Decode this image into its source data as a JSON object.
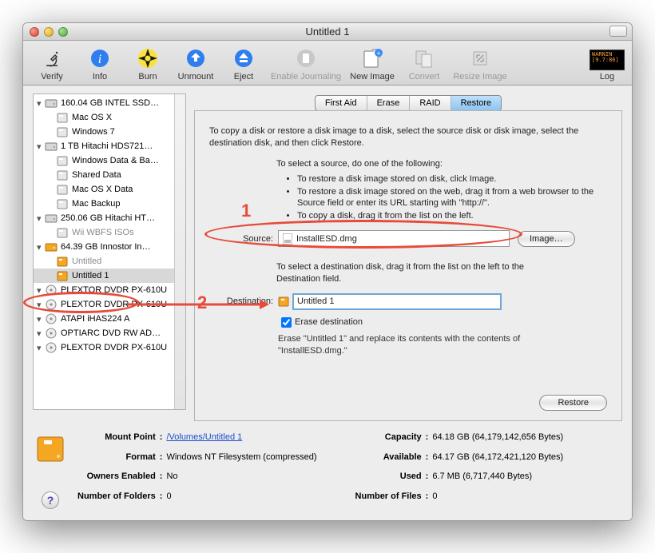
{
  "window": {
    "title": "Untitled 1"
  },
  "toolbar": {
    "verify": "Verify",
    "info": "Info",
    "burn": "Burn",
    "unmount": "Unmount",
    "eject": "Eject",
    "enable_journaling": "Enable Journaling",
    "new_image": "New Image",
    "convert": "Convert",
    "resize_image": "Resize Image",
    "log": "Log"
  },
  "sidebar": {
    "items": [
      {
        "label": "160.04 GB INTEL SSD…",
        "type": "disk"
      },
      {
        "label": "Mac OS X",
        "type": "vol",
        "child": true
      },
      {
        "label": "Windows 7",
        "type": "vol",
        "child": true
      },
      {
        "label": "1 TB Hitachi HDS721…",
        "type": "disk"
      },
      {
        "label": "Windows Data & Ba…",
        "type": "vol",
        "child": true
      },
      {
        "label": "Shared Data",
        "type": "vol",
        "child": true
      },
      {
        "label": "Mac OS X Data",
        "type": "vol",
        "child": true
      },
      {
        "label": "Mac Backup",
        "type": "vol",
        "child": true
      },
      {
        "label": "250.06 GB Hitachi HT…",
        "type": "disk"
      },
      {
        "label": "Wii WBFS ISOs",
        "type": "vol",
        "child": true,
        "grey": true
      },
      {
        "label": "64.39 GB Innostor In…",
        "type": "extdisk"
      },
      {
        "label": "Untitled",
        "type": "extvol",
        "child": true,
        "grey": true
      },
      {
        "label": "Untitled 1",
        "type": "extvol",
        "child": true,
        "selected": true
      },
      {
        "label": "PLEXTOR DVDR PX-610U",
        "type": "optical"
      },
      {
        "label": "PLEXTOR DVDR PX-610U",
        "type": "optical"
      },
      {
        "label": "ATAPI iHAS224 A",
        "type": "optical"
      },
      {
        "label": "OPTIARC DVD RW AD…",
        "type": "optical"
      },
      {
        "label": "PLEXTOR DVDR PX-610U",
        "type": "optical"
      }
    ]
  },
  "tabs": {
    "first_aid": "First Aid",
    "erase": "Erase",
    "raid": "RAID",
    "restore": "Restore"
  },
  "pane": {
    "intro": "To copy a disk or restore a disk image to a disk, select the source disk or disk image, select the destination disk, and then click Restore.",
    "src_help_head": "To select a source, do one of the following:",
    "src_help_b1": "To restore a disk image stored on disk, click Image.",
    "src_help_b2": "To restore a disk image stored on the web, drag it from a web browser to the Source field or enter its URL starting with \"http://\".",
    "src_help_b3": "To copy a disk, drag it from the list on the left.",
    "source_label": "Source:",
    "source_value": "InstallESD.dmg",
    "image_btn": "Image…",
    "dst_help": "To select a destination disk, drag it from the list on the left to the Destination field.",
    "dest_label": "Destination:",
    "dest_value": "Untitled 1",
    "erase_chk": "Erase destination",
    "erase_help": "Erase \"Untitled 1\" and replace its contents with the contents of \"InstallESD.dmg.\"",
    "restore_btn": "Restore"
  },
  "footer": {
    "l": {
      "mount_point_k": "Mount Point",
      "mount_point_v": "/Volumes/Untitled 1",
      "format_k": "Format",
      "format_v": "Windows NT Filesystem (compressed)",
      "owners_k": "Owners Enabled",
      "owners_v": "No",
      "folders_k": "Number of Folders",
      "folders_v": "0"
    },
    "r": {
      "capacity_k": "Capacity",
      "capacity_v": "64.18 GB (64,179,142,656 Bytes)",
      "available_k": "Available",
      "available_v": "64.17 GB (64,172,421,120 Bytes)",
      "used_k": "Used",
      "used_v": "6.7 MB (6,717,440 Bytes)",
      "files_k": "Number of Files",
      "files_v": "0"
    }
  },
  "annotations": {
    "one": "1",
    "two": "2"
  }
}
